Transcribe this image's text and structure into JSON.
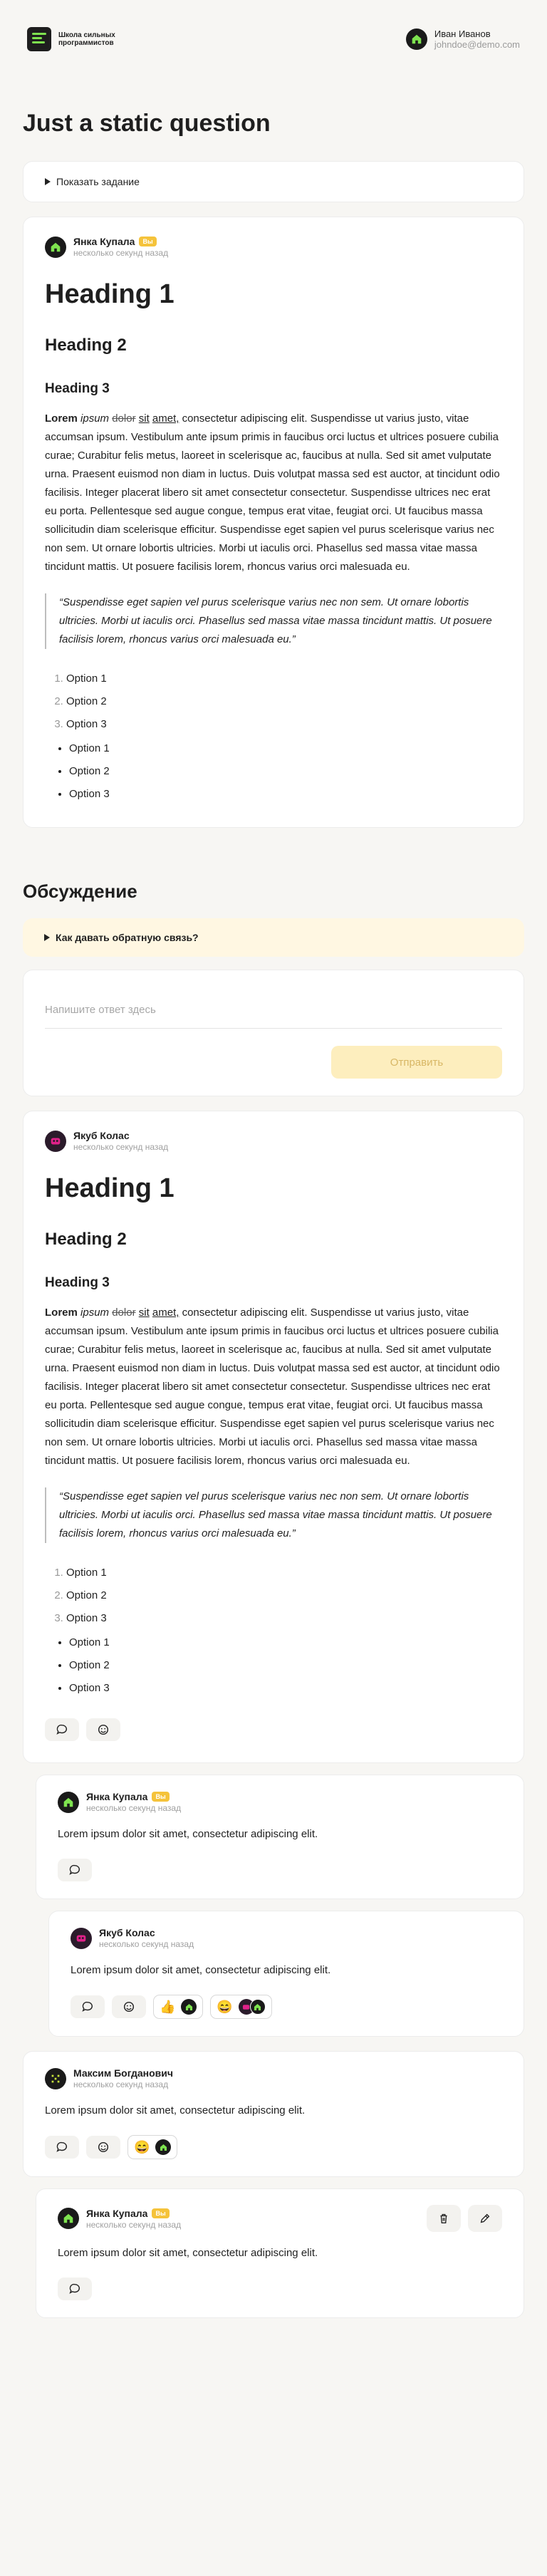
{
  "header": {
    "logo_text": "Школа сильных программистов",
    "user_name": "Иван Иванов",
    "user_email": "johndoe@demo.com"
  },
  "page": {
    "title": "Just a static question",
    "show_task": "Показать задание"
  },
  "content": {
    "h1": "Heading 1",
    "h2": "Heading 2",
    "h3": "Heading 3",
    "p_bold": "Lorem",
    "p_italic": "ipsum",
    "p_strike": "dolor",
    "p_under1": "sit",
    "p_under2": "amet,",
    "p_rest": " consectetur adipiscing elit. Suspendisse ut varius justo, vitae accumsan ipsum. Vestibulum ante ipsum primis in faucibus orci luctus et ultrices posuere cubilia curae; Curabitur felis metus, laoreet in scelerisque ac, faucibus at nulla. Sed sit amet vulputate urna. Praesent euismod non diam in luctus. Duis volutpat massa sed est auctor, at tincidunt odio facilisis. Integer placerat libero sit amet consectetur consectetur. Suspendisse ultrices nec erat eu porta. Pellentesque sed augue congue, tempus erat vitae, feugiat orci. Ut faucibus massa sollicitudin diam scelerisque efficitur. Suspendisse eget sapien vel purus scelerisque varius nec non sem. Ut ornare lobortis ultricies. Morbi ut iaculis orci. Phasellus sed massa vitae massa tincidunt mattis. Ut posuere facilisis lorem, rhoncus varius orci malesuada eu.",
    "quote": "“Suspendisse eget sapien vel purus scelerisque varius nec non sem. Ut ornare lobortis ultricies. Morbi ut iaculis orci. Phasellus sed massa vitae massa tincidunt mattis. Ut posuere facilisis lorem, rhoncus varius orci malesuada eu.”",
    "ordered": [
      "Option 1",
      "Option 2",
      "Option 3"
    ],
    "bullets": [
      "Option 1",
      "Option 2",
      "Option 3"
    ]
  },
  "question_post": {
    "author": "Янка Купала",
    "badge": "Вы",
    "time": "несколько секунд назад"
  },
  "discussion": {
    "title": "Обсуждение",
    "howto": "Как давать обратную связь?",
    "reply_placeholder": "Напишите ответ здесь",
    "send_label": "Отправить"
  },
  "comments": [
    {
      "author": "Якуб Колас",
      "time": "несколько секунд назад"
    },
    {
      "author": "Янка Купала",
      "badge": "Вы",
      "time": "несколько секунд назад",
      "text": "Lorem ipsum dolor sit amet, consectetur adipiscing elit."
    },
    {
      "author": "Якуб Колас",
      "time": "несколько секунд назад",
      "text": "Lorem ipsum dolor sit amet, consectetur adipiscing elit.",
      "reactions": [
        {
          "emoji": "👍"
        },
        {
          "emoji": "😄"
        }
      ]
    },
    {
      "author": "Максим Богданович",
      "time": "несколько секунд назад",
      "text": "Lorem ipsum dolor sit amet, consectetur adipiscing elit.",
      "reactions": [
        {
          "emoji": "😄"
        }
      ]
    },
    {
      "author": "Янка Купала",
      "badge": "Вы",
      "time": "несколько секунд назад",
      "text": "Lorem ipsum dolor sit amet, consectetur adipiscing elit."
    }
  ],
  "colors": {
    "accent": "#f5c33b",
    "send_bg": "#fdeebe",
    "howto_bg": "#fff7e2",
    "logo_green": "#7ee34f"
  }
}
